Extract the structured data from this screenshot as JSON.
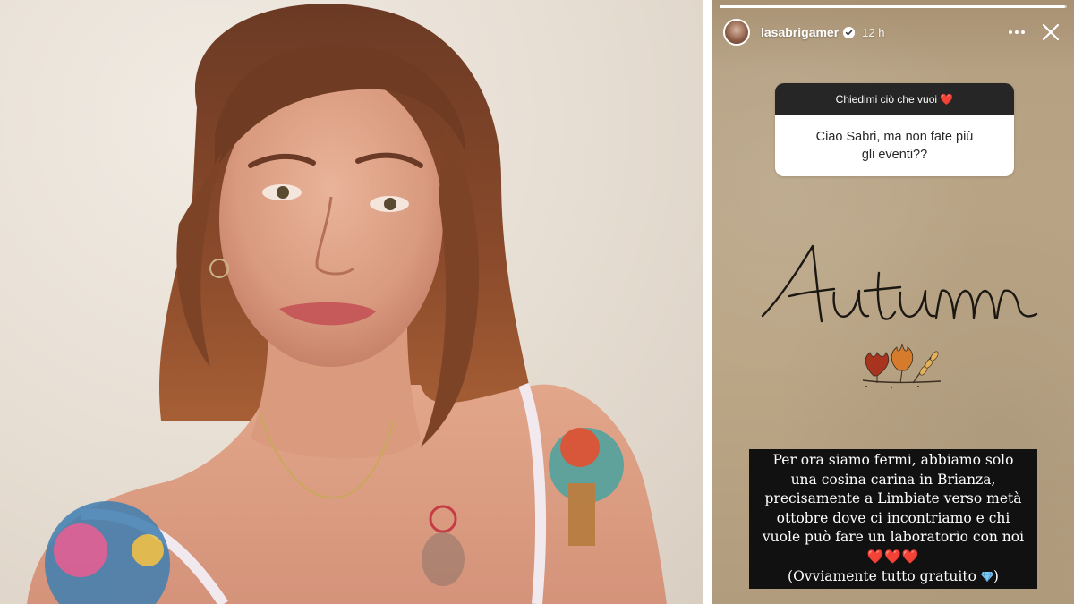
{
  "story": {
    "username": "lasabrigamer",
    "time": "12 h",
    "progress": 0.995,
    "question_header": "Chiedimi ciò che vuoi",
    "question_header_heart": "❤️",
    "question_line1": "Ciao Sabri, ma non fate più",
    "question_line2": "gli eventi??",
    "handwriting": "Autumn",
    "answer_lines": [
      "Per ora siamo fermi, abbiamo solo",
      "una cosina carina in Brianza,",
      "precisamente a Limbiate verso metà",
      "ottobre dove ci incontriamo e chi",
      "vuole può fare un laboratorio con noi",
      "❤️❤️❤️",
      "(Ovviamente tutto gratuito"
    ],
    "answer_closing": ")",
    "icons": {
      "verified": "verified-badge-icon",
      "more": "more-horizontal-icon",
      "close": "close-icon",
      "gem": "gem-icon",
      "leaves": "autumn-leaves-icon"
    },
    "colors": {
      "background": "#b8a283",
      "question_header_bg": "#262626",
      "answer_bg": "#111111",
      "heart": "#e8352f",
      "verified": "#0095f6"
    }
  }
}
